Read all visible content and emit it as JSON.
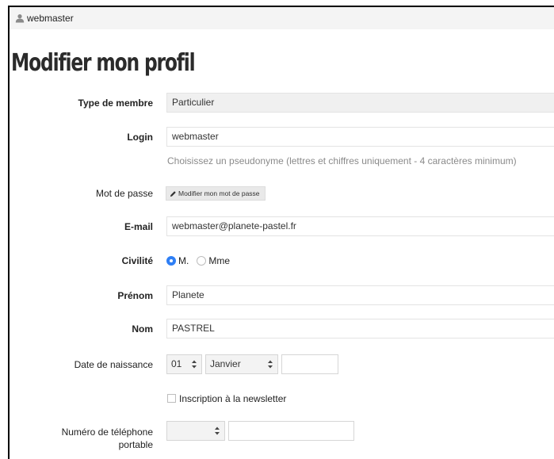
{
  "header": {
    "username": "webmaster",
    "user_icon": "user-icon"
  },
  "page": {
    "title": "Modifier mon profil"
  },
  "form": {
    "member_type": {
      "label": "Type de membre",
      "value": "Particulier"
    },
    "login": {
      "label": "Login",
      "value": "webmaster",
      "help": "Choisissez un pseudonyme (lettres et chiffres uniquement - 4 caractères minimum)"
    },
    "password": {
      "label": "Mot de passe",
      "button_label": "Modifier mon mot de passe",
      "button_icon": "pencil-icon"
    },
    "email": {
      "label": "E-mail",
      "value": "webmaster@planete-pastel.fr"
    },
    "civility": {
      "label": "Civilité",
      "options": [
        "M.",
        "Mme"
      ],
      "selected": "M.",
      "selected_color": "#2f7ff5"
    },
    "first_name": {
      "label": "Prénom",
      "value": "Planete"
    },
    "last_name": {
      "label": "Nom",
      "value": "PASTREL"
    },
    "birth_date": {
      "label": "Date de naissance",
      "day": "01",
      "month": "Janvier",
      "year": ""
    },
    "newsletter": {
      "label": "Inscription à la newsletter",
      "checked": false
    },
    "mobile_phone": {
      "label_line1": "Numéro de téléphone",
      "label_line2": "portable",
      "prefix": "",
      "number": ""
    }
  }
}
